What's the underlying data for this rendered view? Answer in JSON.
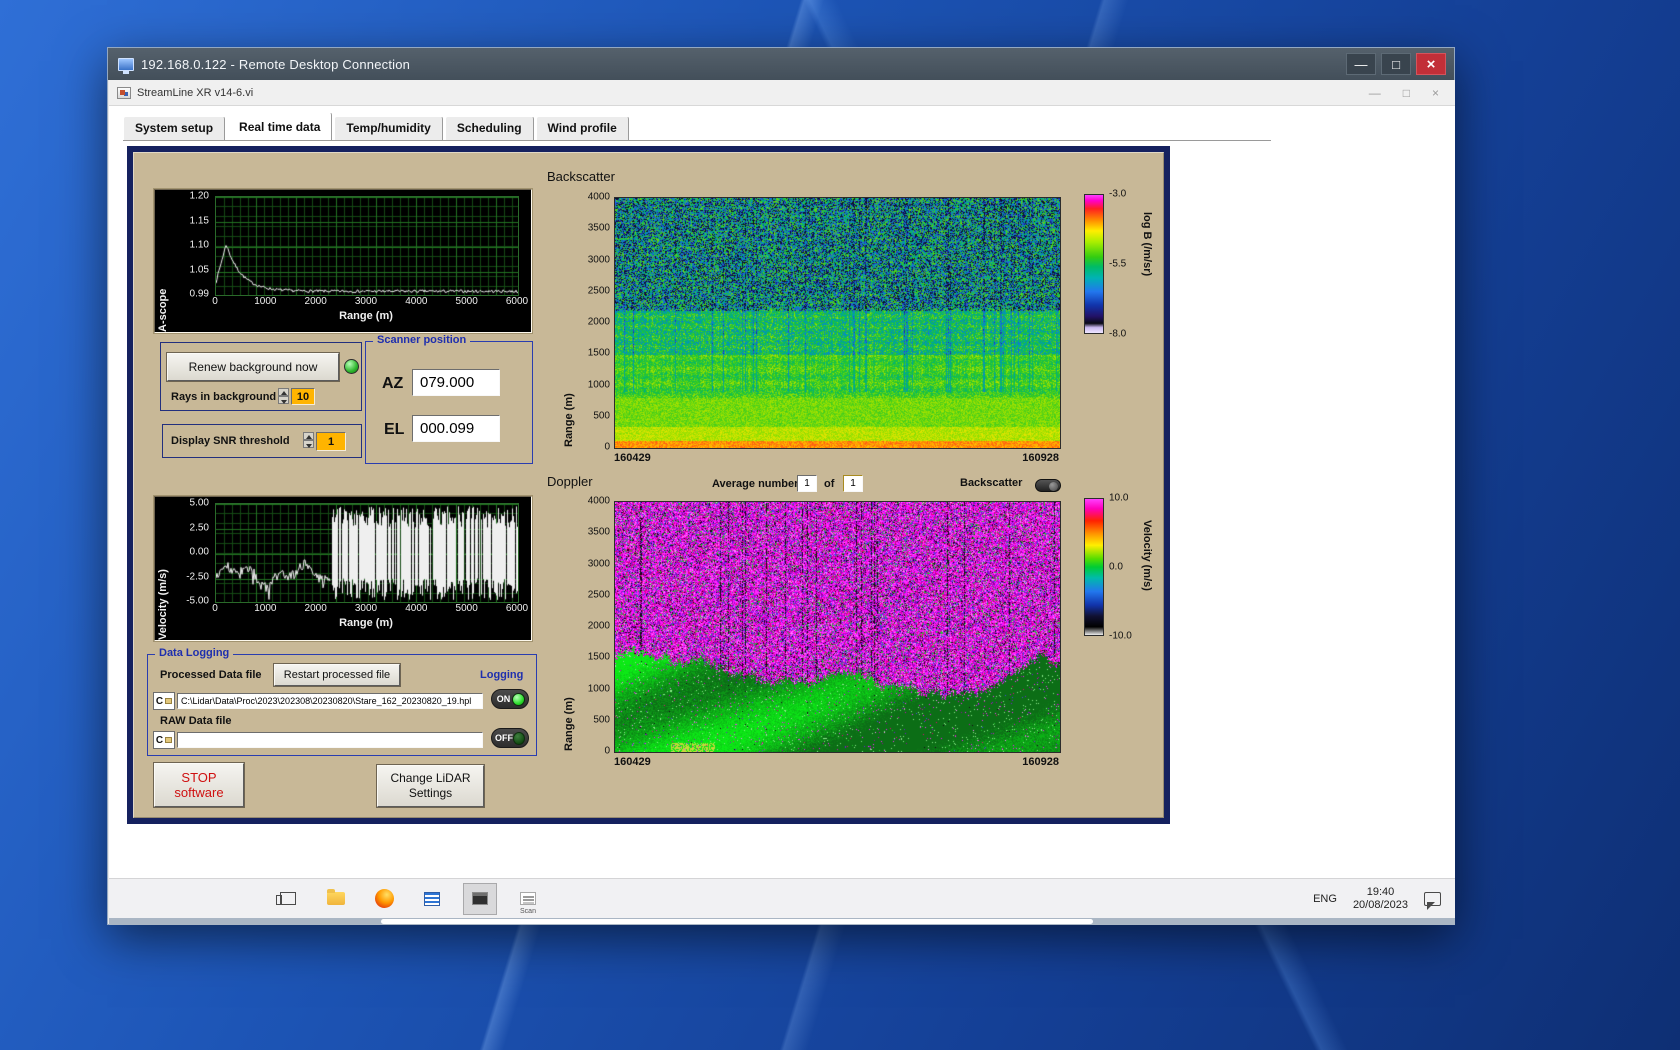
{
  "rdp": {
    "title": "192.168.0.122 - Remote Desktop Connection"
  },
  "glyphs": {
    "minimize": "—",
    "maximize": "□",
    "close": "×"
  },
  "app": {
    "title": "StreamLine XR v14-6.vi",
    "tabs": [
      {
        "label": "System setup",
        "active": false
      },
      {
        "label": "Real time data",
        "active": true
      },
      {
        "label": "Temp/humidity",
        "active": false
      },
      {
        "label": "Scheduling",
        "active": false
      },
      {
        "label": "Wind profile",
        "active": false
      }
    ]
  },
  "ascope": {
    "ylabel": "A-scope",
    "xlabel": "Range (m)",
    "yticks": [
      "1.20",
      "1.15",
      "1.10",
      "1.05",
      "0.99"
    ],
    "xticks": [
      "0",
      "1000",
      "2000",
      "3000",
      "4000",
      "5000",
      "6000"
    ]
  },
  "velocity": {
    "ylabel": "Velocity (m/s)",
    "xlabel": "Range (m)",
    "yticks": [
      "5.00",
      "2.50",
      "0.00",
      "-2.50",
      "-5.00"
    ],
    "xticks": [
      "0",
      "1000",
      "2000",
      "3000",
      "4000",
      "5000",
      "6000"
    ]
  },
  "controls": {
    "renew_button": "Renew background now",
    "rays_label": "Rays in background",
    "rays_value": "10",
    "snr_label": "Display SNR threshold",
    "snr_value": "1"
  },
  "scanner": {
    "title": "Scanner position",
    "az_label": "AZ",
    "az_value": "079.000",
    "el_label": "EL",
    "el_value": "000.099"
  },
  "backscatter": {
    "heading": "Backscatter",
    "ylabel": "Range (m)",
    "yticks": [
      "4000",
      "3500",
      "3000",
      "2500",
      "2000",
      "1500",
      "1000",
      "500",
      "0"
    ],
    "t_start": "160429",
    "t_end": "160928",
    "cbar_ticks": [
      "-3.0",
      "-5.5",
      "-8.0"
    ],
    "cbar_label": "log B (/m/sr)"
  },
  "doppler": {
    "heading": "Doppler",
    "average_label": "Average number",
    "average_value": "1",
    "of_label": "of",
    "of_value": "1",
    "toggle_label": "Backscatter",
    "ylabel": "Range (m)",
    "yticks": [
      "4000",
      "3500",
      "3000",
      "2500",
      "2000",
      "1500",
      "1000",
      "500",
      "0"
    ],
    "t_start": "160429",
    "t_end": "160928",
    "cbar_ticks": [
      "10.0",
      "0.0",
      "-10.0"
    ],
    "cbar_label": "Velocity (m/s)"
  },
  "logging": {
    "title": "Data Logging",
    "processed_label": "Processed Data file",
    "restart_button": "Restart processed file",
    "logging_label": "Logging",
    "drive_letter": "C",
    "processed_path": "C:\\Lidar\\Data\\Proc\\2023\\202308\\20230820\\Stare_162_20230820_19.hpl",
    "raw_label": "RAW Data file",
    "raw_path": "",
    "on_label": "ON",
    "off_label": "OFF"
  },
  "buttons": {
    "stop_line1": "STOP",
    "stop_line2": "software",
    "change_line1": "Change LiDAR",
    "change_line2": "Settings"
  },
  "taskbar": {
    "lang": "ENG",
    "time": "19:40",
    "date": "20/08/2023",
    "scan_caption": "Scan"
  },
  "colors": {
    "panel_tan": "#c8b897",
    "panel_border_navy": "#15215f",
    "amber_value": "#ffb400",
    "led_green": "#2db52d",
    "group_title_blue": "#1f2fae"
  },
  "chart_data": [
    {
      "id": "ascope",
      "type": "line",
      "title": "A-scope",
      "xlabel": "Range (m)",
      "ylabel": "A-scope",
      "xlim": [
        0,
        6000
      ],
      "ylim": [
        0.99,
        1.2
      ],
      "baseline": 0.998,
      "peak": {
        "x_m": 200,
        "value": 1.1
      },
      "description": "Sharp return peak ~1.10 near 150-250 m decaying to a flat noise floor ~1.00 by 1500 m, grid on, black background"
    },
    {
      "id": "velocity",
      "type": "line",
      "title": "Velocity vs range",
      "xlabel": "Range (m)",
      "ylabel": "Velocity (m/s)",
      "xlim": [
        0,
        6000
      ],
      "ylim": [
        -5,
        5
      ],
      "coherent_until_m": 2300,
      "coherent_mean_ms": -2.3,
      "description": "Coherent trace fluctuating around -2 to -3 m/s out to ~2300 m; beyond that uncorrelated full-scale noise shown as dense vertical bars spanning ±5 m/s"
    },
    {
      "id": "backscatter",
      "type": "heatmap",
      "title": "Backscatter",
      "x_start_time": "160429",
      "x_end_time": "160928",
      "ylabel": "Range (m)",
      "ylim_m": [
        0,
        4000
      ],
      "z_label": "log B (/m/sr)",
      "z_ticks": [
        -3.0,
        -5.5,
        -8.0
      ],
      "z_range": [
        -8,
        -3
      ],
      "profile": [
        {
          "range_m": [
            0,
            150
          ],
          "log_B": -4.0,
          "note": "bright yellow-orange surface/near-range band"
        },
        {
          "range_m": [
            150,
            800
          ],
          "log_B": -5.0,
          "note": "bright green aerosol layer"
        },
        {
          "range_m": [
            800,
            1500
          ],
          "log_B": -5.4
        },
        {
          "range_m": [
            1500,
            2200
          ],
          "log_B": -5.8,
          "note": "green with increasing blue/dark speckle"
        },
        {
          "range_m": [
            2200,
            4000
          ],
          "log_B": "-6.5 ± 1.5",
          "note": "uncorrelated blue/black/green speckle noise with dark vertical streaks"
        }
      ]
    },
    {
      "id": "doppler",
      "type": "heatmap",
      "title": "Doppler",
      "x_start_time": "160429",
      "x_end_time": "160928",
      "ylabel": "Range (m)",
      "ylim_m": [
        0,
        4000
      ],
      "z_label": "Velocity (m/s)",
      "z_ticks": [
        10.0,
        0.0,
        -10.0
      ],
      "z_range": [
        -10,
        10
      ],
      "description": "Velocity ≈ 0 m/s (solid green) inside aerosol layer below a ragged boundary varying ~1000-1600 m (dipping near mid-record); uncorrelated ±10 m/s magenta/purple/black speckle noise above"
    }
  ]
}
